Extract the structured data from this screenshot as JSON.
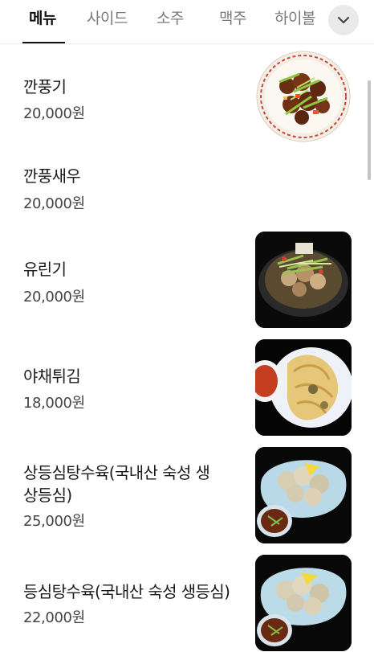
{
  "tabs": [
    {
      "label": "메뉴",
      "active": true
    },
    {
      "label": "사이드",
      "active": false
    },
    {
      "label": "소주",
      "active": false
    },
    {
      "label": "맥주",
      "active": false
    },
    {
      "label": "하이볼",
      "active": false
    }
  ],
  "more_icon": "chevron-down-icon",
  "items": [
    {
      "name": "깐풍기",
      "price": "20,000원",
      "image": "kkanpunggi-dish-photo"
    },
    {
      "name": "깐풍새우",
      "price": "20,000원",
      "image": null
    },
    {
      "name": "유린기",
      "price": "20,000원",
      "image": "yuringi-dish-photo"
    },
    {
      "name": "야채튀김",
      "price": "18,000원",
      "image": "vegetable-tempura-photo"
    },
    {
      "name_line1": "상등심탕수육(국내산 숙성 생",
      "name_line2": "상등심)",
      "price": "25,000원",
      "image": "sweet-sour-pork-photo"
    },
    {
      "name": "등심탕수육(국내산 숙성 생등심)",
      "price": "22,000원",
      "image": "sweet-sour-pork-photo-2"
    }
  ],
  "colors": {
    "active_tab": "#111111",
    "inactive_tab": "#7a7a7a",
    "price": "#444444"
  }
}
